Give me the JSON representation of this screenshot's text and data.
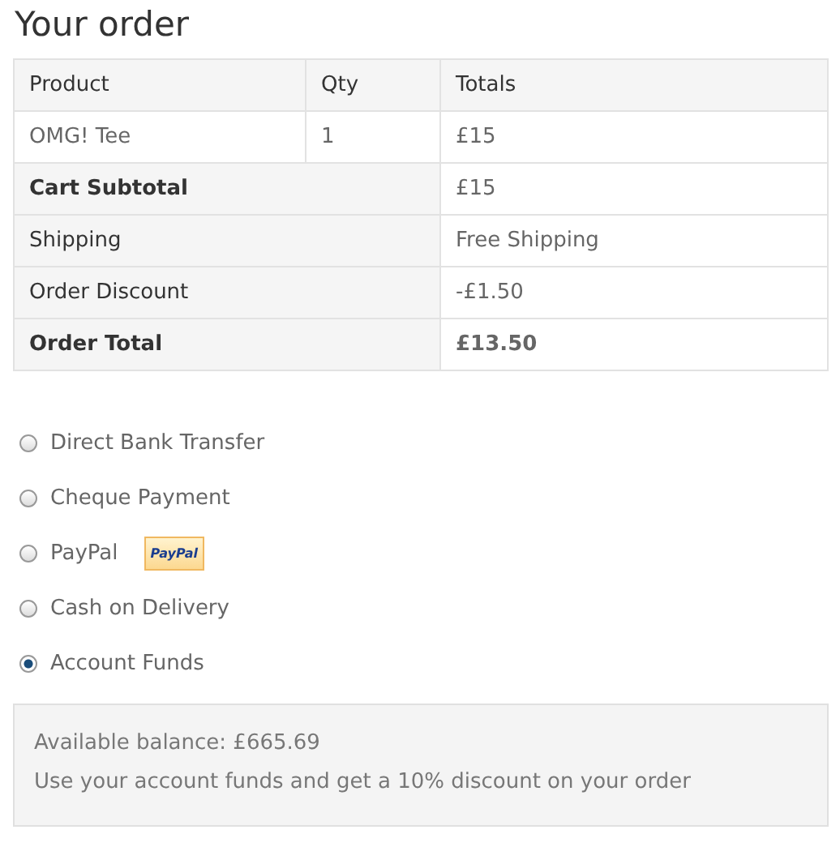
{
  "title": "Your order",
  "table": {
    "columns": [
      "Product",
      "Qty",
      "Totals"
    ],
    "items": [
      {
        "product": "OMG! Tee",
        "qty": "1",
        "total": "£15"
      }
    ],
    "summary": [
      {
        "kind": "subtotal",
        "label": "Cart Subtotal",
        "value": "£15"
      },
      {
        "kind": "line",
        "label": "Shipping",
        "value": "Free Shipping"
      },
      {
        "kind": "line",
        "label": "Order Discount",
        "value": "-£1.50"
      },
      {
        "kind": "total",
        "label": "Order Total",
        "value": "£13.50"
      }
    ]
  },
  "payment_methods": [
    {
      "label": "Direct Bank Transfer",
      "selected": false
    },
    {
      "label": "Cheque Payment",
      "selected": false
    },
    {
      "label": "PayPal",
      "selected": false,
      "badge": "PayPal"
    },
    {
      "label": "Cash on Delivery",
      "selected": false
    },
    {
      "label": "Account Funds",
      "selected": true
    }
  ],
  "info_box": [
    "Available balance: £665.69",
    "Use your account funds and get a 10% discount on your order"
  ]
}
